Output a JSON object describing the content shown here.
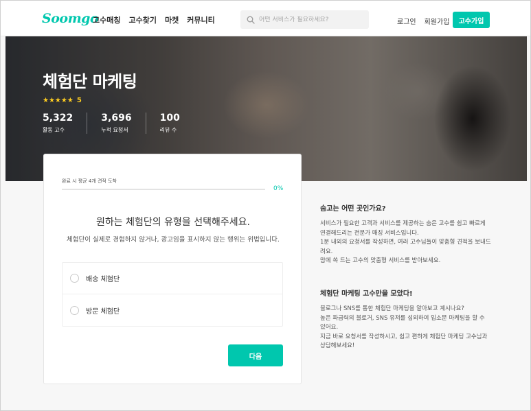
{
  "header": {
    "logo": "Soomgo",
    "nav": [
      "고수매칭",
      "고수찾기",
      "마켓",
      "커뮤니티"
    ],
    "search_placeholder": "어떤 서비스가 필요하세요?",
    "login": "로그인",
    "signup": "회원가입",
    "pro_signup": "고수가입"
  },
  "hero": {
    "title": "체험단 마케팅",
    "stars": "★★★★★",
    "rating": "5",
    "stats": [
      {
        "value": "5,322",
        "label": "활동 고수"
      },
      {
        "value": "3,696",
        "label": "누적 요청서"
      },
      {
        "value": "100",
        "label": "리뷰 수"
      }
    ]
  },
  "card": {
    "progress_label": "완료 시 평균 4개 견적 도착",
    "progress_percent": "0%",
    "progress_value": 0,
    "question": "원하는 체험단의 유형을 선택해주세요.",
    "description": "체험단이 실제로 경험하지 않거나, 광고임을 표시하지 않는 행위는 위법입니다.",
    "options": [
      "배송 체험단",
      "방문 체험단"
    ],
    "next_label": "다음"
  },
  "info": [
    {
      "title": "숨고는 어떤 곳인가요?",
      "lines": [
        "서비스가 필요한 고객과 서비스를 제공하는 숨은 고수를 쉽고 빠르게 연결해드리는 전문가 매칭 서비스입니다.",
        "1분 내외의 요청서를 작성하면, 여러 고수님들이 맞춤형 견적을 보내드려요.",
        "맘에 쏙 드는 고수의 맞춤형 서비스를 받아보세요."
      ]
    },
    {
      "title": "체험단 마케팅 고수만을 모았다!",
      "lines": [
        "블로그나 SNS를 통한 체험단 마케팅을 알아보고 계시나요?",
        "높은 파급력의 블로거, SNS 유저를 섭외하여 입소문 마케팅을 할 수 있어요.",
        "지금 바로 요청서를 작성하시고, 쉽고 편하게 체험단 마케팅 고수님과 상담해보세요!"
      ]
    }
  ],
  "colors": {
    "accent": "#00c7ae",
    "star": "#ffce21"
  }
}
